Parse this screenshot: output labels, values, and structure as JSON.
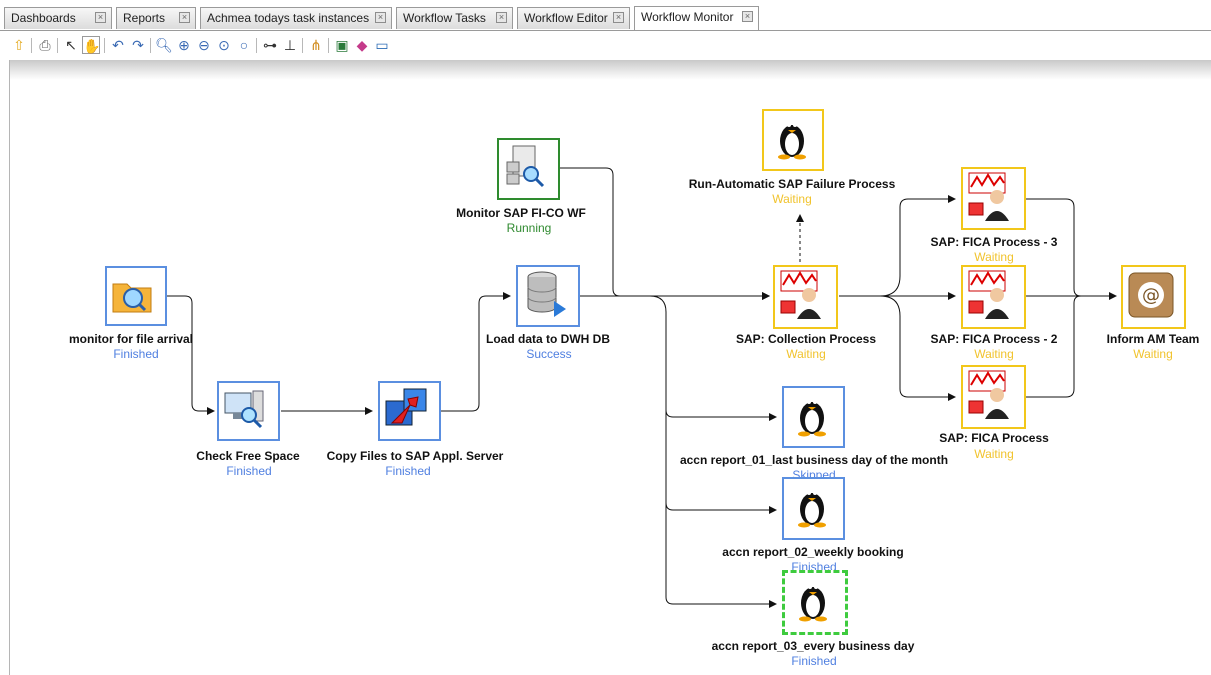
{
  "tabs": [
    {
      "label": "Dashboards"
    },
    {
      "label": "Reports"
    },
    {
      "label": "Achmea todays task instances"
    },
    {
      "label": "Workflow Tasks"
    },
    {
      "label": "Workflow Editor"
    },
    {
      "label": "Workflow Monitor"
    }
  ],
  "active_tab": "Workflow Monitor",
  "toolbar_icons": [
    "up-arrow-icon",
    "print-icon",
    "pointer-icon",
    "hand-icon",
    "undo-icon",
    "redo-icon",
    "zoom-icon",
    "zoom-in-icon",
    "zoom-out-icon",
    "zoom-fit-icon",
    "zoom-reset-icon",
    "layout-horizontal-icon",
    "layout-tree-icon",
    "layout-org-icon",
    "export-image-icon",
    "palette-icon",
    "screen-icon"
  ],
  "nodes": {
    "monitor_file": {
      "label": "monitor for file arrival",
      "status": "Finished",
      "icon": "folder-search-icon"
    },
    "check_space": {
      "label": "Check Free Space",
      "status": "Finished",
      "icon": "computer-search-icon"
    },
    "copy_files": {
      "label": "Copy Files to SAP Appl. Server",
      "status": "Finished",
      "icon": "transfer-icon"
    },
    "load_dwh": {
      "label": "Load data to DWH DB",
      "status": "Success",
      "icon": "database-icon"
    },
    "monitor_sap": {
      "label": "Monitor SAP FI-CO WF",
      "status": "Running",
      "icon": "document-search-icon"
    },
    "run_auto": {
      "label": "Run-Automatic SAP Failure Process",
      "status": "Waiting",
      "icon": "linux-penguin-icon"
    },
    "sap_collection": {
      "label": "SAP: Collection Process",
      "status": "Waiting",
      "icon": "sap-process-icon"
    },
    "fica3": {
      "label": "SAP: FICA Process - 3",
      "status": "Waiting",
      "icon": "sap-process-icon"
    },
    "fica2": {
      "label": "SAP: FICA Process - 2",
      "status": "Waiting",
      "icon": "sap-process-icon"
    },
    "fica": {
      "label": "SAP: FICA Process",
      "status": "Waiting",
      "icon": "sap-process-icon"
    },
    "inform_am": {
      "label": "Inform AM Team",
      "status": "Waiting",
      "icon": "email-icon"
    },
    "report01": {
      "label": "accn report_01_last business day of the month",
      "status": "Skipped",
      "icon": "linux-penguin-icon"
    },
    "report02": {
      "label": "accn report_02_weekly booking",
      "status": "Finished",
      "icon": "linux-penguin-icon"
    },
    "report03": {
      "label": "accn report_03_every business day",
      "status": "Finished",
      "icon": "linux-penguin-icon"
    }
  },
  "colors": {
    "finished": "#4f7fe0",
    "waiting": "#f1c32d",
    "running": "#2f8a2f",
    "box_blue": "#5b8fe0",
    "box_yellow": "#f2c71a",
    "box_green": "#2e8b2e",
    "box_dashed_green": "#3ecb3e"
  }
}
